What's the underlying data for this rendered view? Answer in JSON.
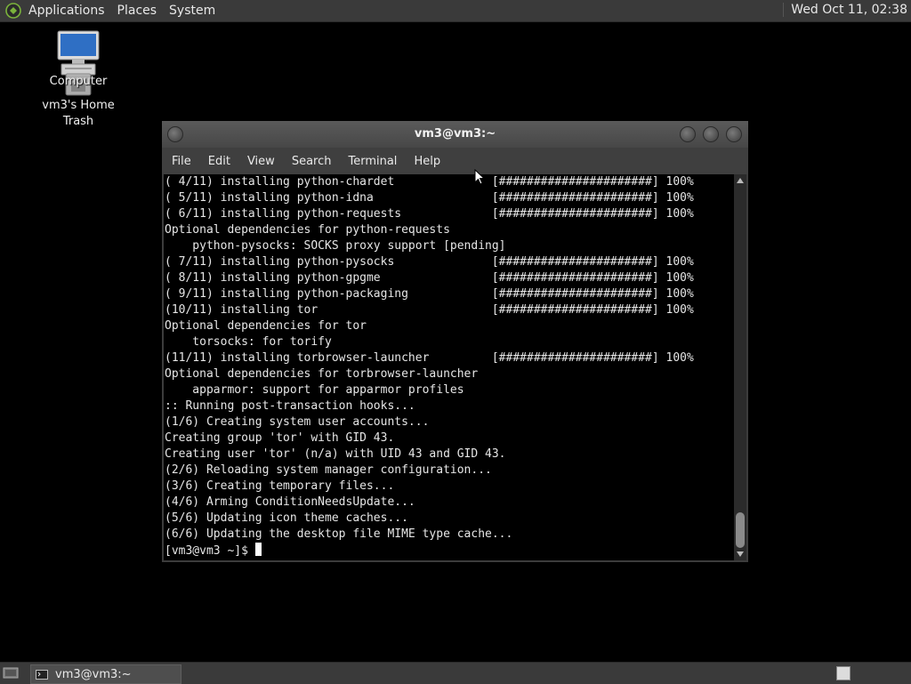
{
  "top_panel": {
    "menus": [
      "Applications",
      "Places",
      "System"
    ],
    "clock": "Wed Oct 11, 02:38"
  },
  "desktop": {
    "icons": [
      {
        "label": "Computer",
        "icon": "computer-icon"
      },
      {
        "label": "vm3's Home",
        "icon": "home-folder-icon"
      },
      {
        "label": "Trash",
        "icon": "trash-icon"
      }
    ]
  },
  "window": {
    "title": "vm3@vm3:~",
    "menus": [
      "File",
      "Edit",
      "View",
      "Search",
      "Terminal",
      "Help"
    ]
  },
  "terminal": {
    "lines": [
      "( 4/11) installing python-chardet              [######################] 100%",
      "( 5/11) installing python-idna                 [######################] 100%",
      "( 6/11) installing python-requests             [######################] 100%",
      "Optional dependencies for python-requests",
      "    python-pysocks: SOCKS proxy support [pending]",
      "( 7/11) installing python-pysocks              [######################] 100%",
      "( 8/11) installing python-gpgme                [######################] 100%",
      "( 9/11) installing python-packaging            [######################] 100%",
      "(10/11) installing tor                         [######################] 100%",
      "Optional dependencies for tor",
      "    torsocks: for torify",
      "(11/11) installing torbrowser-launcher         [######################] 100%",
      "Optional dependencies for torbrowser-launcher",
      "    apparmor: support for apparmor profiles",
      ":: Running post-transaction hooks...",
      "(1/6) Creating system user accounts...",
      "Creating group 'tor' with GID 43.",
      "Creating user 'tor' (n/a) with UID 43 and GID 43.",
      "(2/6) Reloading system manager configuration...",
      "(3/6) Creating temporary files...",
      "(4/6) Arming ConditionNeedsUpdate...",
      "(5/6) Updating icon theme caches...",
      "(6/6) Updating the desktop file MIME type cache..."
    ],
    "prompt": "[vm3@vm3 ~]$ "
  },
  "bottom_panel": {
    "task_label": "vm3@vm3:~"
  },
  "colors": {
    "panel_bg": "#3a3a3a",
    "terminal_bg": "#000000",
    "terminal_fg": "#e6e6e6",
    "logo_green": "#7bb33c"
  }
}
